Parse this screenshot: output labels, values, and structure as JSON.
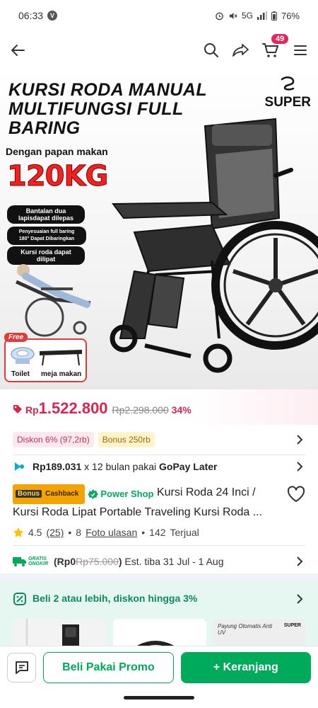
{
  "status_bar": {
    "time": "06:33",
    "badge": "V",
    "network": "5G",
    "battery": "76%"
  },
  "app_bar": {
    "cart_count": "49"
  },
  "hero": {
    "title_lines": [
      "KURSI RODA MANUAL",
      "MULTIFUNGSI FULL",
      "BARING"
    ],
    "brand": "SUPER",
    "subtitle": "Dengan papan makan",
    "weight": "120KG",
    "features": [
      "Bantalan dua lapisdapat dilepas",
      "Penyesuaian full baring 180° Dapat Dibaringkan",
      "Kursi roda dapat dilipat"
    ],
    "free_tag": "Free",
    "free_items": [
      "Toilet",
      "meja makan"
    ]
  },
  "price": {
    "currency": "Rp",
    "current": "1.522.800",
    "original": "Rp2.298.000",
    "discount_pct": "34%"
  },
  "promo_badges": {
    "discount": "Diskon 6% (97,2rb)",
    "bonus": "Bonus 250rb"
  },
  "paylater": {
    "amount": "Rp189.031",
    "terms": "x 12 bulan pakai",
    "provider": "GoPay Later"
  },
  "product": {
    "cashback_tag_a": "Bonus",
    "cashback_tag_b": "Cashback",
    "shop_tag": "Power Shop",
    "name": "Kursi Roda 24 Inci / Kursi Roda Lipat Portable Traveling Kursi Roda ..."
  },
  "rating": {
    "score": "4.5",
    "reviews": "(25)",
    "photos": "8",
    "photos_label": "Foto ulasan",
    "sold": "142",
    "sold_label": "Terjual"
  },
  "shipping": {
    "logo_line1": "GRATIS",
    "logo_line2": "ONGKIR",
    "price_open": "(Rp0",
    "original": "Rp75.000",
    "close": ")",
    "eta": "Est. tiba 31 Jul - 1 Aug"
  },
  "bundle_promo": {
    "text": "Beli 2 atau lebih, diskon hingga 3%",
    "thumb_caption": "Payung Otomatis Anti UV",
    "thumb_brand": "SUPER"
  },
  "bottom_bar": {
    "buy_label": "Beli Pakai Promo",
    "cart_label": "+ Keranjang"
  },
  "colors": {
    "accent_green": "#00aa5b",
    "price_red": "#d8264f"
  }
}
